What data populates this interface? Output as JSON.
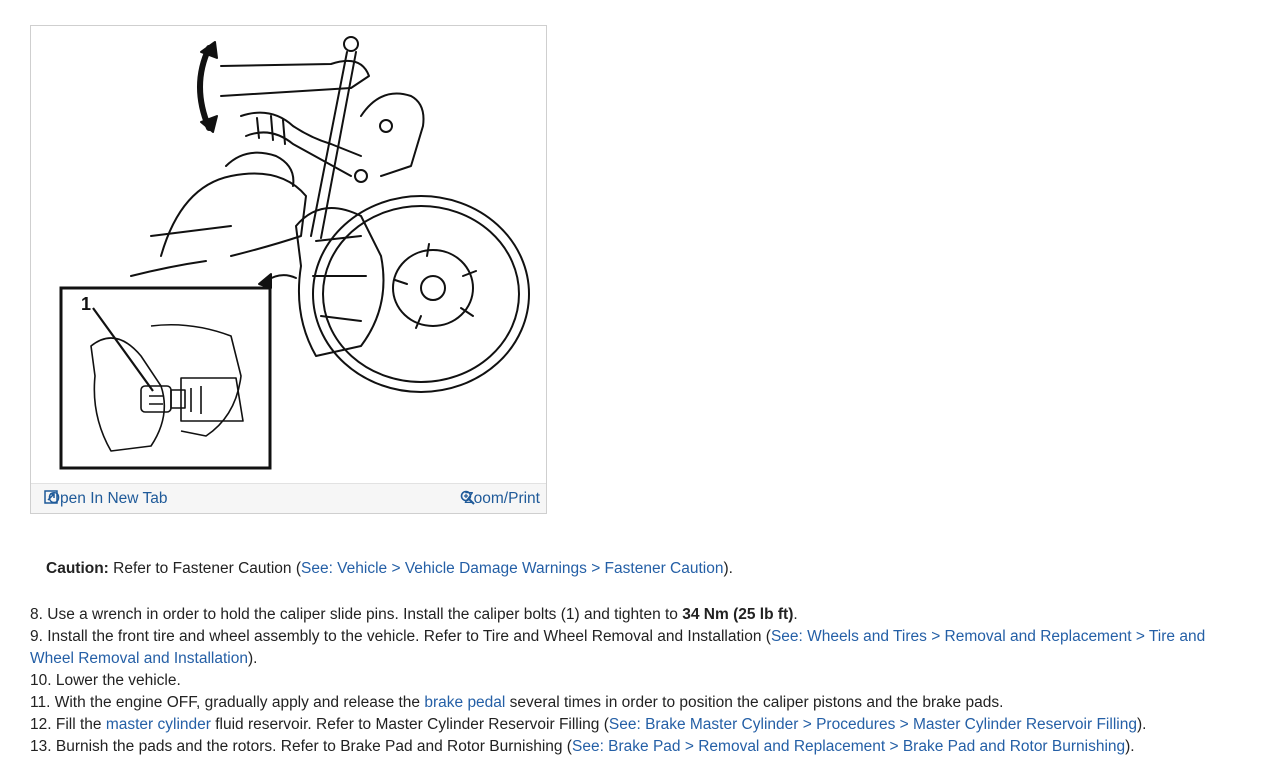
{
  "figure": {
    "callout_number": "1",
    "open_tab_label": "Open In New Tab",
    "zoom_label": "Zoom/Print",
    "open_tab_icon": "open-new-tab-icon",
    "zoom_icon": "magnifier-zoom-icon"
  },
  "caution": {
    "label": "Caution:",
    "text": "Refer to Fastener Caution (",
    "link": "See: Vehicle > Vehicle Damage Warnings > Fastener Caution",
    "after": ")."
  },
  "steps": [
    {
      "num": " 8.",
      "text": "Use a wrench in order to hold the caliper slide pins. Install the caliper bolts (1) and tighten to ",
      "bold": "34 Nm (25 lb ft)",
      "after": "."
    },
    {
      "num": " 9.",
      "text": "Install the front tire and wheel assembly to the vehicle. Refer to Tire and Wheel Removal and Installation (",
      "link": "See: Wheels and Tires > Removal and Replacement > Tire and Wheel Removal and Installation",
      "after": ")."
    },
    {
      "num": "10.",
      "text": "Lower the vehicle."
    },
    {
      "num": "11.",
      "pre": "With the engine OFF, gradually apply and release the ",
      "link": "brake pedal",
      "after": " several times in order to position the caliper pistons and the brake pads."
    },
    {
      "num": "12.",
      "pre": "Fill the ",
      "link": "master cylinder",
      "mid": " fluid reservoir. Refer to Master Cylinder Reservoir Filling (",
      "link2": "See: Brake Master Cylinder > Procedures > Master Cylinder Reservoir Filling",
      "after": ")."
    },
    {
      "num": "13.",
      "text": "Burnish the pads and the rotors. Refer to Brake Pad and Rotor Burnishing (",
      "link": "See: Brake Pad > Removal and Replacement > Brake Pad and Rotor Burnishing",
      "after": ")."
    }
  ]
}
